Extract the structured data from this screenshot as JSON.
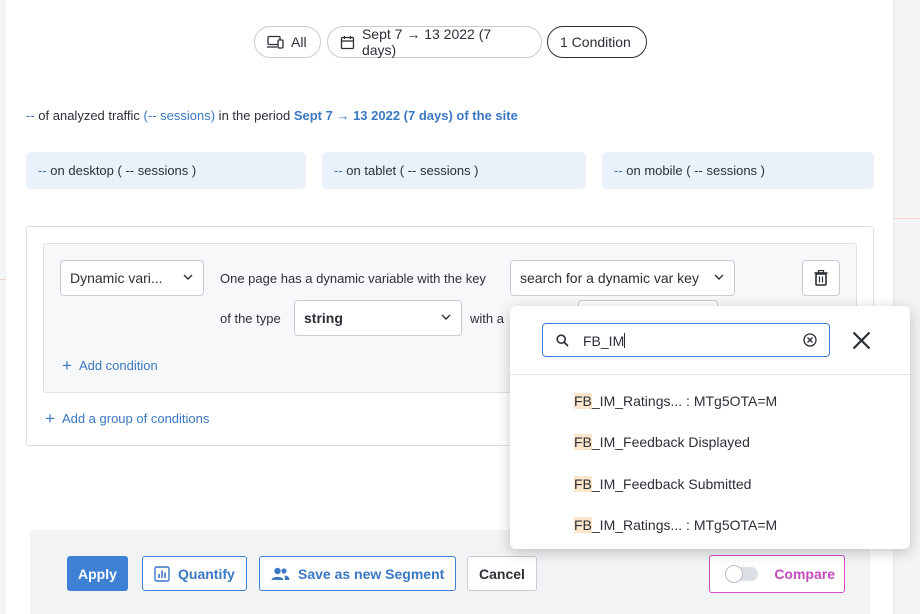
{
  "filters": {
    "device_label": "All",
    "date_label": "Sept 7 → 13 2022 (7 days)",
    "condition_label": "1 Condition"
  },
  "summary": {
    "dash": "--",
    "text1": " of analyzed traffic ",
    "sessions": "(-- sessions)",
    "text2": " in the period ",
    "period": "Sept 7 → 13 2022 (7 days) of the site"
  },
  "devices": {
    "desktop_dash": "--",
    "desktop_text": " on desktop ( -- sessions )",
    "tablet_dash": "--",
    "tablet_text": " on tablet ( -- sessions )",
    "mobile_dash": "--",
    "mobile_text": " on mobile ( -- sessions )"
  },
  "condition": {
    "type_select": "Dynamic vari...",
    "sentence1": "One page has a dynamic variable with the key",
    "key_select": "search for a dynamic var key",
    "sentence2": "of the type",
    "type_value": "string",
    "sentence3": "with a",
    "add_condition": "Add condition",
    "add_group": "Add a group of conditions"
  },
  "dropdown": {
    "search_value": "FB_IM",
    "options": [
      {
        "highlight": "FB",
        "rest": "_IM_Ratings... : MTg5OTA=M"
      },
      {
        "highlight": "FB",
        "rest": "_IM_Feedback Displayed"
      },
      {
        "highlight": "FB",
        "rest": "_IM_Feedback Submitted"
      },
      {
        "highlight": "FB",
        "rest": "_IM_Ratings... : MTg5OTA=M"
      }
    ]
  },
  "actions": {
    "apply": "Apply",
    "quantify": "Quantify",
    "save_segment": "Save as new Segment",
    "cancel": "Cancel",
    "compare": "Compare"
  },
  "colors": {
    "accent": "#3d80d4",
    "link": "#3a78c4",
    "compare": "#c54bbd",
    "highlight": "#fbe6cc"
  }
}
